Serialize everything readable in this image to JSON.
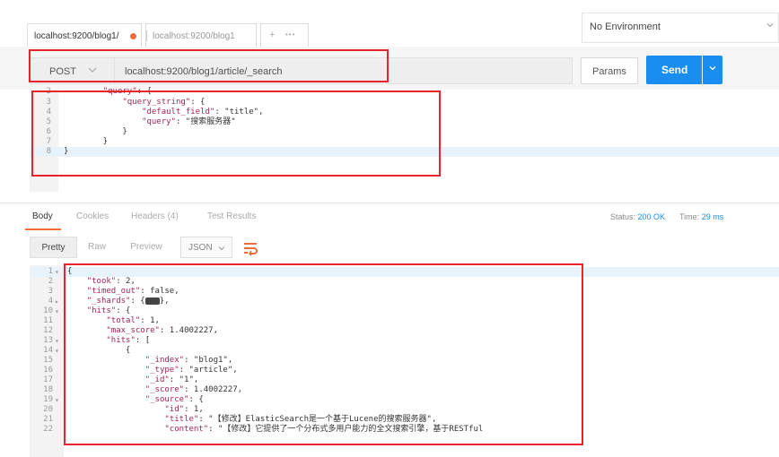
{
  "tabs": [
    {
      "label": "localhost:9200/blog1/",
      "active": true,
      "unsaved": true
    },
    {
      "label": "localhost:9200/blog1",
      "active": false
    }
  ],
  "tab_actions": {
    "add": "+",
    "more": "•••"
  },
  "environment": {
    "label": "No Environment"
  },
  "request": {
    "method": "POST",
    "url": "localhost:9200/blog1/article/_search",
    "params_label": "Params",
    "send_label": "Send"
  },
  "request_body": [
    {
      "ln": "2",
      "text": "    \"query\": {"
    },
    {
      "ln": "3",
      "text": "        \"query_string\": {"
    },
    {
      "ln": "4",
      "text": "            \"default_field\": \"title\","
    },
    {
      "ln": "5",
      "text": "            \"query\": \"搜索服务器\""
    },
    {
      "ln": "6",
      "text": "        }"
    },
    {
      "ln": "7",
      "text": "    }"
    },
    {
      "ln": "8",
      "text": "}"
    }
  ],
  "response_tabs": {
    "body": "Body",
    "cookies": "Cookies",
    "headers": "Headers (4)",
    "tests": "Test Results"
  },
  "response_status": {
    "status_label": "Status:",
    "status_value": "200 OK",
    "time_label": "Time:",
    "time_value": "29 ms"
  },
  "format": {
    "pretty": "Pretty",
    "raw": "Raw",
    "preview": "Preview",
    "type": "JSON"
  },
  "response_body": [
    {
      "ln": "1",
      "fold": "▾",
      "text": "{"
    },
    {
      "ln": "2",
      "fold": "",
      "text": "    \"took\": 2,"
    },
    {
      "ln": "3",
      "fold": "",
      "text": "    \"timed_out\": false,"
    },
    {
      "ln": "4",
      "fold": "▸",
      "text": "    \"_shards\": {▬},"
    },
    {
      "ln": "10",
      "fold": "▾",
      "text": "    \"hits\": {"
    },
    {
      "ln": "11",
      "fold": "",
      "text": "        \"total\": 1,"
    },
    {
      "ln": "12",
      "fold": "",
      "text": "        \"max_score\": 1.4002227,"
    },
    {
      "ln": "13",
      "fold": "▾",
      "text": "        \"hits\": ["
    },
    {
      "ln": "14",
      "fold": "▾",
      "text": "            {"
    },
    {
      "ln": "15",
      "fold": "",
      "text": "                \"_index\": \"blog1\","
    },
    {
      "ln": "16",
      "fold": "",
      "text": "                \"_type\": \"article\","
    },
    {
      "ln": "17",
      "fold": "",
      "text": "                \"_id\": \"1\","
    },
    {
      "ln": "18",
      "fold": "",
      "text": "                \"_score\": 1.4002227,"
    },
    {
      "ln": "19",
      "fold": "▾",
      "text": "                \"_source\": {"
    },
    {
      "ln": "20",
      "fold": "",
      "text": "                    \"id\": 1,"
    },
    {
      "ln": "21",
      "fold": "",
      "text": "                    \"title\": \"【修改】ElasticSearch是一个基于Lucene的搜索服务器\","
    },
    {
      "ln": "22",
      "fold": "",
      "text": "                    \"content\": \"【修改】它提供了一个分布式多用户能力的全文搜索引擎，基于RESTful"
    }
  ],
  "colors": {
    "accent": "#1a8df0",
    "unsaved_dot": "#f26b3a",
    "highlight_box": "#e8232c"
  }
}
